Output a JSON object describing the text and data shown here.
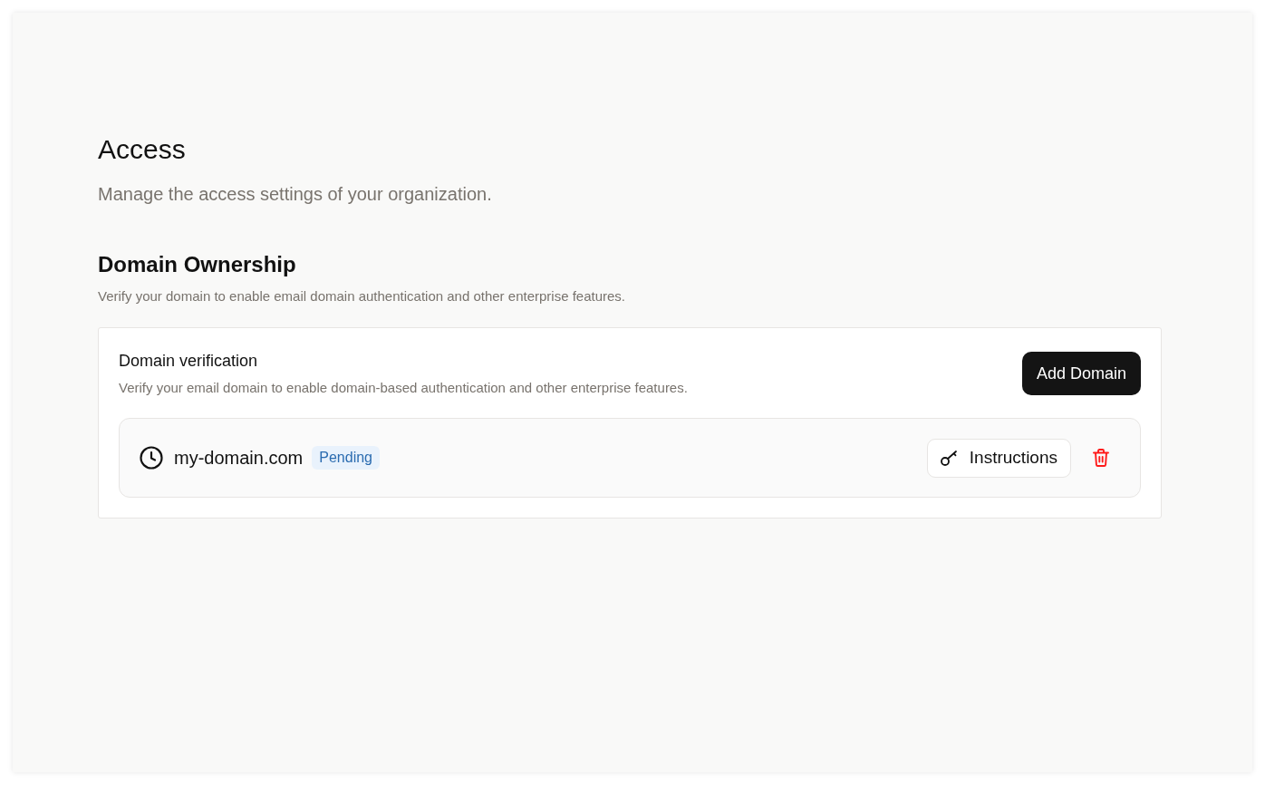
{
  "page": {
    "title": "Access",
    "subtitle": "Manage the access settings of your organization."
  },
  "section": {
    "title": "Domain Ownership",
    "description": "Verify your domain to enable email domain authentication and other enterprise features."
  },
  "card": {
    "title": "Domain verification",
    "description": "Verify your email domain to enable domain-based authentication and other enterprise features.",
    "add_button": "Add Domain",
    "domains": [
      {
        "name": "my-domain.com",
        "status": {
          "label": "Pending",
          "kind": "pending"
        },
        "instructions_button": "Instructions"
      }
    ]
  }
}
